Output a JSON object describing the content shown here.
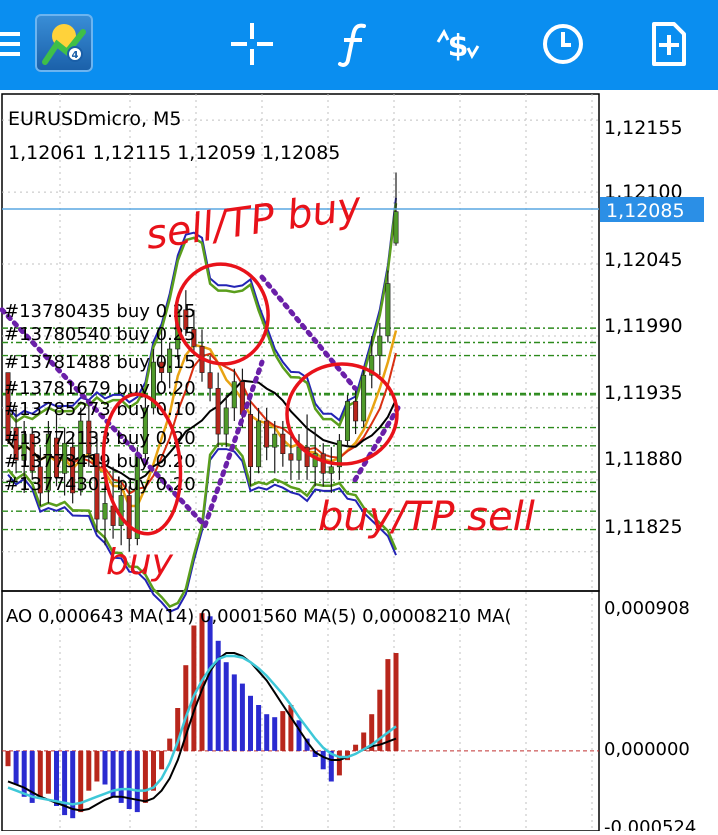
{
  "toolbar": {
    "items": [
      "menu-icon",
      "app-logo-icon",
      "crosshair-icon",
      "function-icon",
      "trade-icon",
      "history-icon",
      "new-order-icon"
    ],
    "bg_color": "#0a8ef0"
  },
  "chart_header": {
    "symbol": "EURUSDmicro, M5",
    "ohlc": "1,12061 1,12115 1,12059 1,12085"
  },
  "price_axis": {
    "ticks": [
      "1,12155",
      "1,12100",
      "1,12045",
      "1,11990",
      "1,11935",
      "1,11880",
      "1,11825"
    ],
    "current_price": "1,12085",
    "current_price_color": "#2b8fe6"
  },
  "orders": [
    "#13780435 buy 0.25",
    "#13780540 buy 0.25",
    "#13781488 buy 0.15",
    "#13781679 buy 0.20",
    "#13785273 buy 0.10",
    "#13772133 buy 0.20",
    "#13773419 buy 0.20",
    "#13774301 buy 0.20"
  ],
  "annotations": {
    "top": "sell/TP buy",
    "left": "buy",
    "right": "buy/TP sell",
    "color": "#e8121a"
  },
  "indicator": {
    "label": "AO 0,000643 MA(14) 0,0001560 MA(5) 0,00008210 MA(",
    "ticks": [
      "0,000908",
      "0,000000",
      "-0,000524"
    ],
    "up_color": "#b8261c",
    "down_color": "#2b2bd0"
  },
  "chart_data": [
    {
      "type": "candlestick",
      "series": [
        {
          "name": "candles",
          "values": [
            [
              1.11962,
              1.11955,
              1.11914,
              1.1191
            ],
            [
              1.1192,
              1.11935,
              1.11885,
              1.11895
            ],
            [
              1.11895,
              1.11925,
              1.1187,
              1.11915
            ],
            [
              1.11915,
              1.1192,
              1.1188,
              1.11887
            ],
            [
              1.1189,
              1.11905,
              1.1186,
              1.1187
            ],
            [
              1.11872,
              1.11925,
              1.11862,
              1.11915
            ],
            [
              1.11912,
              1.1193,
              1.11875,
              1.11882
            ],
            [
              1.11885,
              1.1192,
              1.11868,
              1.11908
            ],
            [
              1.11905,
              1.11915,
              1.11862,
              1.1187
            ],
            [
              1.11872,
              1.11935,
              1.11868,
              1.11925
            ],
            [
              1.11925,
              1.1194,
              1.1189,
              1.119
            ],
            [
              1.119,
              1.11915,
              1.1184,
              1.1185
            ],
            [
              1.1185,
              1.11875,
              1.1183,
              1.11862
            ],
            [
              1.1186,
              1.1189,
              1.11835,
              1.11845
            ],
            [
              1.11845,
              1.1188,
              1.1183,
              1.11868
            ],
            [
              1.11868,
              1.11875,
              1.11825,
              1.11835
            ],
            [
              1.11835,
              1.11905,
              1.1183,
              1.119
            ],
            [
              1.119,
              1.11945,
              1.1189,
              1.11935
            ],
            [
              1.11935,
              1.1198,
              1.1193,
              1.1197
            ],
            [
              1.1197,
              1.11995,
              1.11955,
              1.11962
            ],
            [
              1.11962,
              1.11985,
              1.1195,
              1.1198
            ],
            [
              1.1198,
              1.1202,
              1.11972,
              1.1201
            ],
            [
              1.1201,
              1.12025,
              1.1199,
              1.11995
            ],
            [
              1.11995,
              1.1201,
              1.11975,
              1.11982
            ],
            [
              1.11982,
              1.11995,
              1.11955,
              1.11962
            ],
            [
              1.11962,
              1.11975,
              1.1194,
              1.1195
            ],
            [
              1.1195,
              1.11962,
              1.11905,
              1.11915
            ],
            [
              1.11915,
              1.11945,
              1.11905,
              1.11935
            ],
            [
              1.11935,
              1.11965,
              1.11925,
              1.11955
            ],
            [
              1.11955,
              1.11965,
              1.1192,
              1.1193
            ],
            [
              1.1193,
              1.11945,
              1.11875,
              1.1189
            ],
            [
              1.1189,
              1.11935,
              1.11885,
              1.11925
            ],
            [
              1.11925,
              1.11935,
              1.11895,
              1.11905
            ],
            [
              1.11905,
              1.11925,
              1.11885,
              1.11915
            ],
            [
              1.11915,
              1.11925,
              1.1189,
              1.119
            ],
            [
              1.119,
              1.11915,
              1.1188,
              1.11895
            ],
            [
              1.11895,
              1.11915,
              1.1188,
              1.11905
            ],
            [
              1.11905,
              1.1193,
              1.1188,
              1.1189
            ],
            [
              1.1189,
              1.1192,
              1.11875,
              1.119
            ],
            [
              1.119,
              1.11908,
              1.11875,
              1.11885
            ],
            [
              1.11885,
              1.11905,
              1.1187,
              1.1189
            ],
            [
              1.1189,
              1.11915,
              1.1188,
              1.1191
            ],
            [
              1.1191,
              1.11945,
              1.11905,
              1.1194
            ],
            [
              1.1194,
              1.1195,
              1.11915,
              1.11925
            ],
            [
              1.11925,
              1.11965,
              1.1192,
              1.1196
            ],
            [
              1.1196,
              1.1199,
              1.1195,
              1.11975
            ],
            [
              1.11975,
              1.12,
              1.1196,
              1.1199
            ],
            [
              1.1199,
              1.1204,
              1.11985,
              1.1203
            ],
            [
              1.12061,
              1.12115,
              1.12059,
              1.12085
            ]
          ]
        }
      ],
      "ylim": [
        1.11795,
        1.12175
      ]
    },
    {
      "type": "bar",
      "series": [
        {
          "name": "AO",
          "values": [
            -0.0001,
            -0.00022,
            -0.0003,
            -0.00034,
            -0.0003,
            -0.00028,
            -0.00036,
            -0.00042,
            -0.00044,
            -0.0004,
            -0.00026,
            -0.0002,
            -0.00022,
            -0.0003,
            -0.00034,
            -0.00038,
            -0.0004,
            -0.00034,
            -0.00026,
            -0.00012,
            8e-05,
            0.00028,
            0.00056,
            0.00082,
            0.0009,
            0.00088,
            0.00072,
            0.00058,
            0.0005,
            0.00044,
            0.00036,
            0.0003,
            0.00024,
            0.00022,
            0.00026,
            0.0003,
            0.0002,
            8e-05,
            -4e-05,
            -0.00012,
            -0.0002,
            -0.00016,
            -6e-05,
            4e-05,
            0.00012,
            0.00024,
            0.0004,
            0.0006,
            0.00064
          ]
        },
        {
          "name": "MA(14)",
          "values": [
            -0.00024,
            -0.00026,
            -0.00028,
            -0.0003,
            -0.00031,
            -0.00032,
            -0.00033,
            -0.00034,
            -0.00035,
            -0.00034,
            -0.00032,
            -0.0003,
            -0.00028,
            -0.00026,
            -0.00025,
            -0.00025,
            -0.00026,
            -0.00026,
            -0.00024,
            -0.00018,
            -8e-05,
            6e-05,
            0.00022,
            0.00036,
            0.00046,
            0.00054,
            0.0006,
            0.00062,
            0.00062,
            0.00061,
            0.00058,
            0.00054,
            0.00049,
            0.00043,
            0.00037,
            0.0003,
            0.00022,
            0.00015,
            8e-05,
            2e-05,
            -2e-05,
            -4e-05,
            -4e-05,
            -2e-05,
            1e-05,
            4e-05,
            8e-05,
            0.00012,
            0.00016
          ]
        },
        {
          "name": "MA(5)",
          "values": [
            -0.0002,
            -0.00022,
            -0.00024,
            -0.00027,
            -0.0003,
            -0.00032,
            -0.00034,
            -0.00036,
            -0.00038,
            -0.00039,
            -0.00038,
            -0.00035,
            -0.00032,
            -0.0003,
            -0.0003,
            -0.00031,
            -0.00032,
            -0.00033,
            -0.00031,
            -0.00026,
            -0.00018,
            -6e-05,
            0.0001,
            0.00026,
            0.0004,
            0.00052,
            0.0006,
            0.00064,
            0.00064,
            0.00062,
            0.00058,
            0.00052,
            0.00046,
            0.00038,
            0.0003,
            0.00022,
            0.00014,
            6e-05,
            -1e-05,
            -4e-05,
            -6e-05,
            -6e-05,
            -4e-05,
            -2e-05,
            1e-05,
            3e-05,
            4e-05,
            6e-05,
            8e-05
          ]
        }
      ],
      "ylim": [
        -0.000524,
        0.000908
      ]
    }
  ]
}
